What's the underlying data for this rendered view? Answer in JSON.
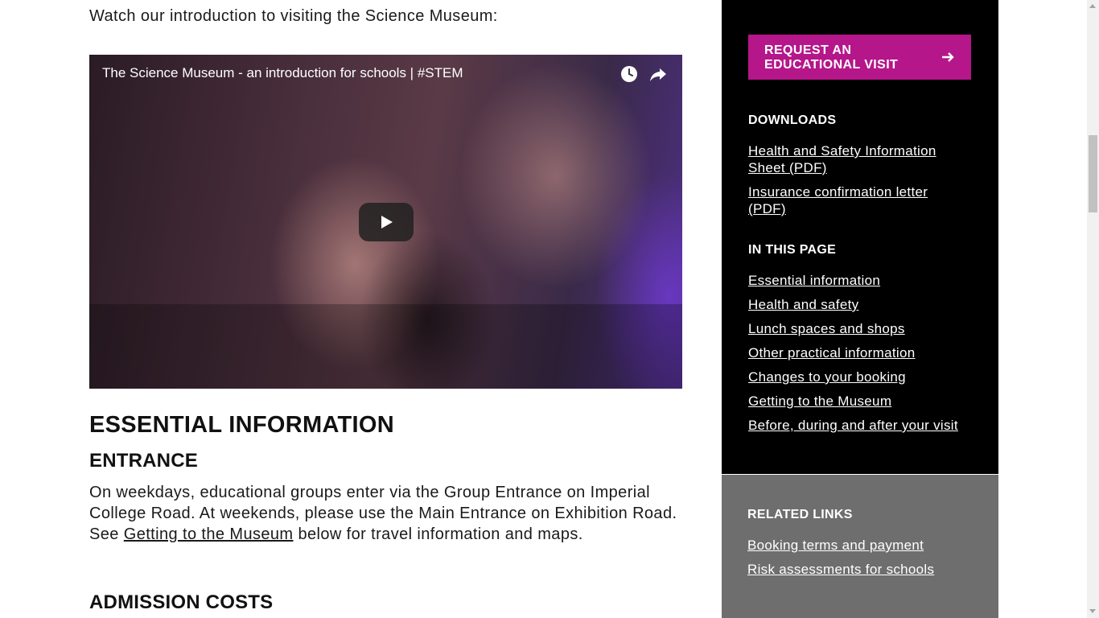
{
  "main": {
    "intro": "Watch our introduction to visiting the Science Museum:",
    "video": {
      "title": "The Science Museum - an introduction for schools | #STEM",
      "watch_later_icon": "clock-icon",
      "share_icon": "share-arrow-icon",
      "play_icon": "play-icon"
    },
    "essential_heading": "ESSENTIAL INFORMATION",
    "entrance": {
      "heading": "ENTRANCE",
      "text_before_link": "On weekdays, educational groups enter via the Group Entrance on Imperial College Road. At weekends, please use the Main Entrance on Exhibition Road. See ",
      "link": "Getting to the Museum",
      "text_after_link": " below for travel information and maps."
    },
    "admission_heading": "ADMISSION COSTS"
  },
  "sidebar": {
    "request_button": "REQUEST AN EDUCATIONAL VISIT",
    "request_icon": "arrow-right-icon",
    "downloads": {
      "heading": "DOWNLOADS",
      "links": [
        "Health and Safety Information Sheet (PDF)",
        "Insurance confirmation letter (PDF)"
      ]
    },
    "in_this_page": {
      "heading": "IN THIS PAGE",
      "links": [
        "Essential information",
        "Health and safety",
        "Lunch spaces and shops",
        "Other practical information",
        "Changes to your booking",
        "Getting to the Museum",
        "Before, during and after your visit"
      ]
    },
    "related": {
      "heading": "RELATED LINKS",
      "links": [
        "Booking terms and payment",
        "Risk assessments for schools"
      ]
    }
  },
  "colors": {
    "accent": "#b5168a",
    "sidebar_dark": "#000000",
    "sidebar_grey": "#6e6e6e"
  }
}
